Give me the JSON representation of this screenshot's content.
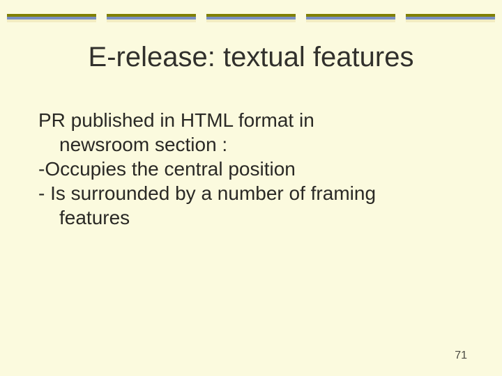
{
  "slide": {
    "title": "E-release: textual features",
    "body": {
      "line1": "PR published in HTML format in",
      "line2": "newsroom section :",
      "line3": "-Occupies the central position",
      "line4": "- Is surrounded by a number of framing",
      "line5": "features"
    },
    "page_number": "71"
  }
}
